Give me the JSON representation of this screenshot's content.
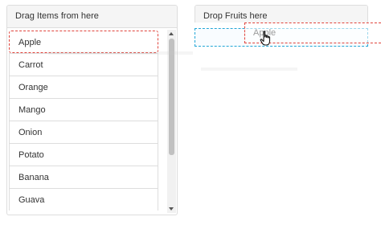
{
  "left_panel": {
    "title": "Drag Items from here",
    "items": [
      {
        "label": "Apple"
      },
      {
        "label": "Carrot"
      },
      {
        "label": "Orange"
      },
      {
        "label": "Mango"
      },
      {
        "label": "Onion"
      },
      {
        "label": "Potato"
      },
      {
        "label": "Banana"
      },
      {
        "label": "Guava"
      }
    ]
  },
  "right_panel": {
    "title": "Drop Fruits here"
  },
  "dragged_item": {
    "label": "Apple"
  },
  "colors": {
    "drag_border": "#e0443c",
    "drop_border": "#22a6d6",
    "panel_heading_bg": "#f5f5f5",
    "panel_border": "#dddddd"
  },
  "icons": [
    "hand-cursor-icon",
    "scroll-up-arrow-icon",
    "scroll-down-arrow-icon"
  ]
}
